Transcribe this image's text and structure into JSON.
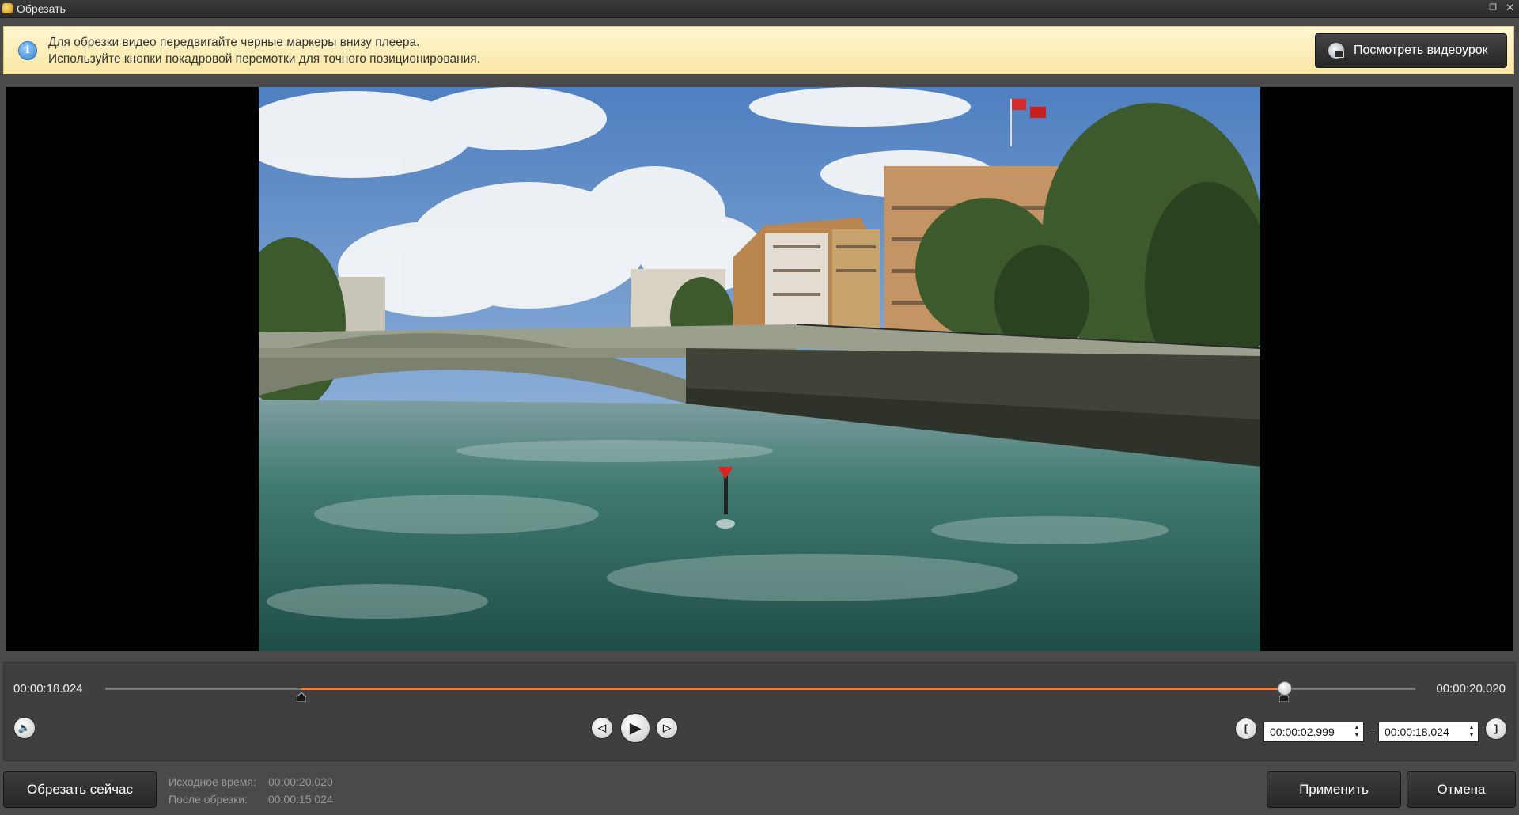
{
  "window": {
    "title": "Обрезать"
  },
  "banner": {
    "line1": "Для обрезки видео передвигайте черные маркеры внизу плеера.",
    "line2": "Используйте кнопки покадровой перемотки для точного позиционирования.",
    "tutorial_button": "Посмотреть видеоурок"
  },
  "player": {
    "time_current": "00:00:18.024",
    "time_total": "00:00:20.020",
    "trim_start": "00:00:02.999",
    "trim_end": "00:00:18.024",
    "dash": "–",
    "selection_start_fraction": 0.15,
    "selection_end_fraction": 0.9
  },
  "footer": {
    "trim_now_button": "Обрезать сейчас",
    "source_time_label": "Исходное время:",
    "source_time_value": "00:00:20.020",
    "after_trim_label": "После обрезки:",
    "after_trim_value": "00:00:15.024",
    "apply_button": "Применить",
    "cancel_button": "Отмена"
  },
  "icons": {
    "info": "info-icon",
    "tutorial": "video-tutorial-icon",
    "volume": "speaker-icon",
    "prev_frame": "step-back-icon",
    "play": "play-icon",
    "next_frame": "step-forward-icon",
    "set_start": "set-start-marker-icon",
    "set_end": "set-end-marker-icon"
  },
  "colors": {
    "accent_selection": "#ff7a2a",
    "banner_bg": "#f8e7a4",
    "panel_bg": "#4a4a4a"
  }
}
